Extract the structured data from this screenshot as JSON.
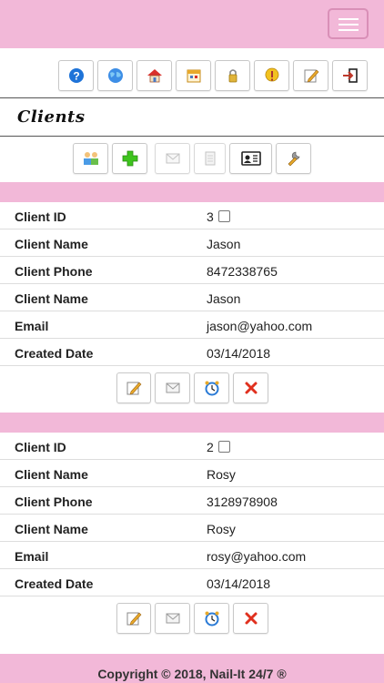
{
  "header": {
    "menu_icon": "hamburger-menu-icon"
  },
  "nav_icons": [
    {
      "name": "help-icon",
      "color": "#1e73d8"
    },
    {
      "name": "globe-icon",
      "color": "#2b7bd6"
    },
    {
      "name": "home-icon",
      "color": "#d9302b"
    },
    {
      "name": "calendar-icon",
      "color": "#e8a92a"
    },
    {
      "name": "lock-icon",
      "color": "#d4a017"
    },
    {
      "name": "alert-icon",
      "color": "#e8b21a"
    },
    {
      "name": "edit-icon",
      "color": "#e8a92a"
    },
    {
      "name": "logout-icon",
      "color": "#c0392b"
    }
  ],
  "page": {
    "title": "Clients"
  },
  "toolbar_icons": [
    {
      "name": "groups-icon"
    },
    {
      "name": "add-icon"
    },
    {
      "name": "mail-icon"
    },
    {
      "name": "document-icon"
    },
    {
      "name": "contact-card-icon"
    },
    {
      "name": "wrench-icon"
    }
  ],
  "field_labels": {
    "id": "Client ID",
    "name": "Client Name",
    "phone": "Client Phone",
    "name2": "Client Name",
    "email": "Email",
    "created": "Created Date"
  },
  "clients": [
    {
      "id": "3",
      "name": "Jason",
      "phone": "8472338765",
      "name2": "Jason",
      "email": "jason@yahoo.com",
      "created": "03/14/2018"
    },
    {
      "id": "2",
      "name": "Rosy",
      "phone": "3128978908",
      "name2": "Rosy",
      "email": "rosy@yahoo.com",
      "created": "03/14/2018"
    }
  ],
  "footer": {
    "copyright": "Copyright © 2018, Nail-It 24/7 ®"
  },
  "colors": {
    "accent_pink": "#f2b8d8",
    "border_pink": "#d98fb7"
  }
}
